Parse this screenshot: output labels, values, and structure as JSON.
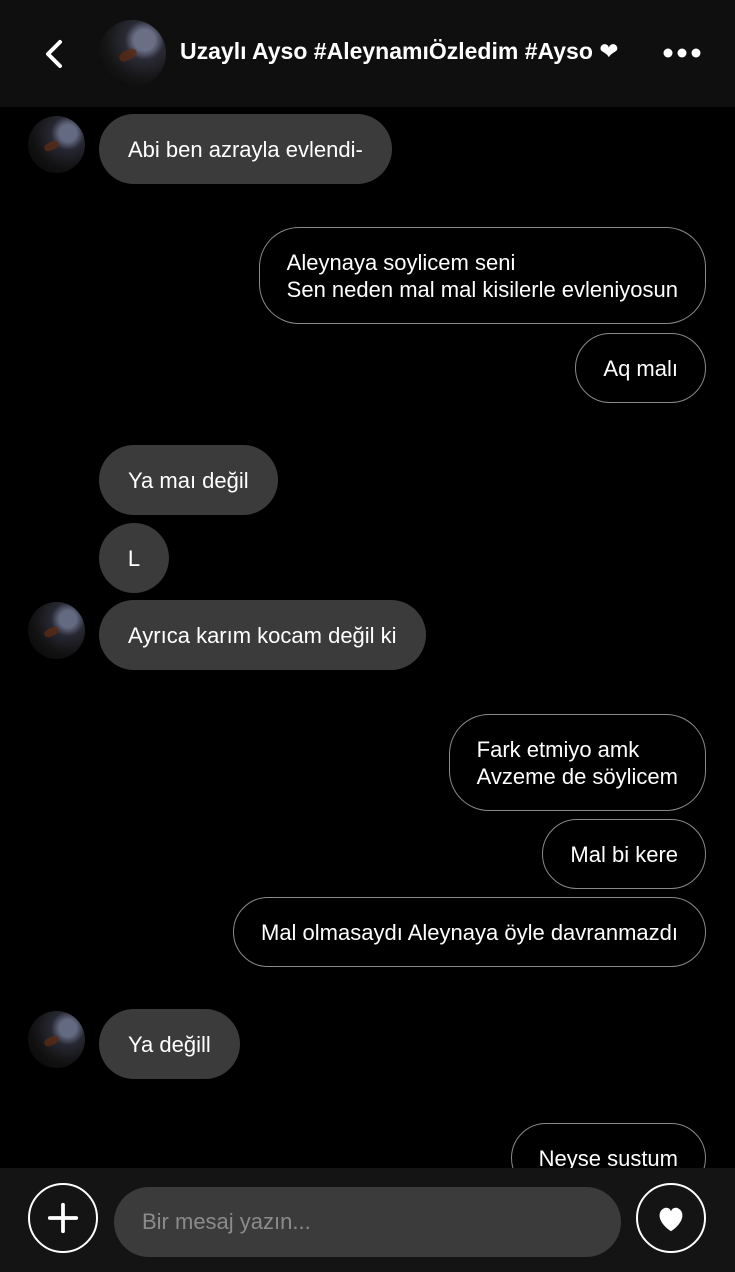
{
  "header": {
    "back_icon": "chevron-left-icon",
    "title": "Uzaylı Ayso #AleynamıÖzledim  #Ayso ❤",
    "more_icon": "more-horizontal-icon"
  },
  "messages": [
    {
      "side": "in",
      "text": "Abi ben azrayla evlendi-"
    },
    {
      "side": "out",
      "text": "Aleynaya soylicem seni\nSen neden mal mal kisilerle evleniyosun"
    },
    {
      "side": "out",
      "text": "Aq malı"
    },
    {
      "side": "in",
      "text": "Ya maı değil"
    },
    {
      "side": "in",
      "text": "L"
    },
    {
      "side": "in",
      "text": "Ayrıca karım kocam değil ki"
    },
    {
      "side": "out",
      "text": "Fark etmiyo amk\nAvzeme de söylicem"
    },
    {
      "side": "out",
      "text": "Mal bi kere"
    },
    {
      "side": "out",
      "text": "Mal olmasaydı Aleynaya öyle davranmazdı"
    },
    {
      "side": "in",
      "text": "Ya değill"
    },
    {
      "side": "out",
      "text": "Neyse sustum"
    }
  ],
  "composer": {
    "placeholder": "Bir mesaj yazın...",
    "value": "",
    "plus_icon": "plus-icon",
    "heart_icon": "heart-icon"
  }
}
